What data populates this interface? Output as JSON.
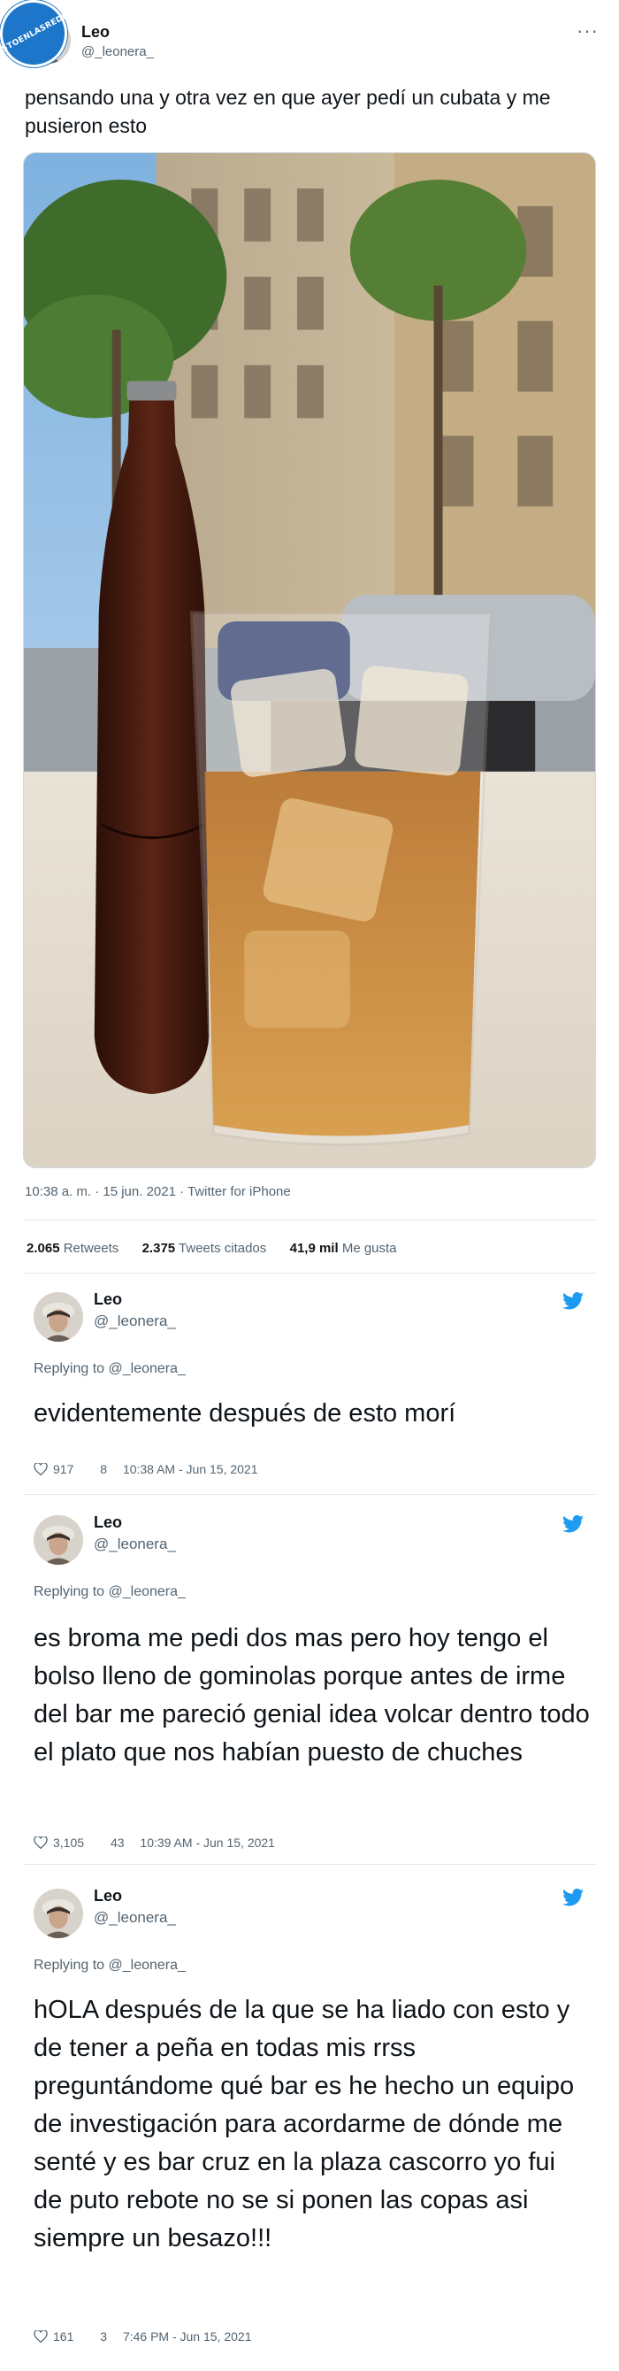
{
  "badge": {
    "text": "VISTOENLASREDES"
  },
  "tweet": {
    "name": "Leo",
    "handle": "@_leonera_",
    "more_icon": "more-icon",
    "text": "pensando una y otra vez en que ayer pedí un cubata y me pusieron esto",
    "timestamp": "10:38 a. m. · 15 jun. 2021 · Twitter for iPhone",
    "retweets_count": "2.065",
    "retweets_label": "Retweets",
    "quotes_count": "2.375",
    "quotes_label": "Tweets citados",
    "likes_count": "41,9 mil",
    "likes_label": "Me gusta"
  },
  "replies": [
    {
      "name": "Leo",
      "handle": "@_leonera_",
      "replying_to": "Replying to @_leonera_",
      "text": "evidentemente después de esto morí",
      "likes": "917",
      "replies": "8",
      "time": "10:38 AM - Jun 15, 2021"
    },
    {
      "name": "Leo",
      "handle": "@_leonera_",
      "replying_to": "Replying to @_leonera_",
      "text": "es broma me pedi dos mas pero hoy tengo el bolso lleno de gominolas porque antes de irme del bar me pareció genial idea volcar dentro todo el plato que nos habían puesto de chuches",
      "likes": "3,105",
      "replies": "43",
      "time": "10:39 AM - Jun 15, 2021"
    },
    {
      "name": "Leo",
      "handle": "@_leonera_",
      "replying_to": "Replying to @_leonera_",
      "text": "hOLA después de la que se ha liado con esto y de tener a peña en todas mis rrss preguntándome qué bar es he hecho un equipo de investigación para acordarme de dónde me senté y es bar cruz en la plaza cascorro yo fui de puto rebote no se si ponen las copas asi siempre un besazo!!!",
      "likes": "161",
      "replies": "3",
      "time": "7:46 PM - Jun 15, 2021"
    }
  ],
  "colors": {
    "twitter_blue": "#1d9bf0",
    "text": "#0f1419",
    "muted": "#536471",
    "badge": "#1d76c9"
  }
}
